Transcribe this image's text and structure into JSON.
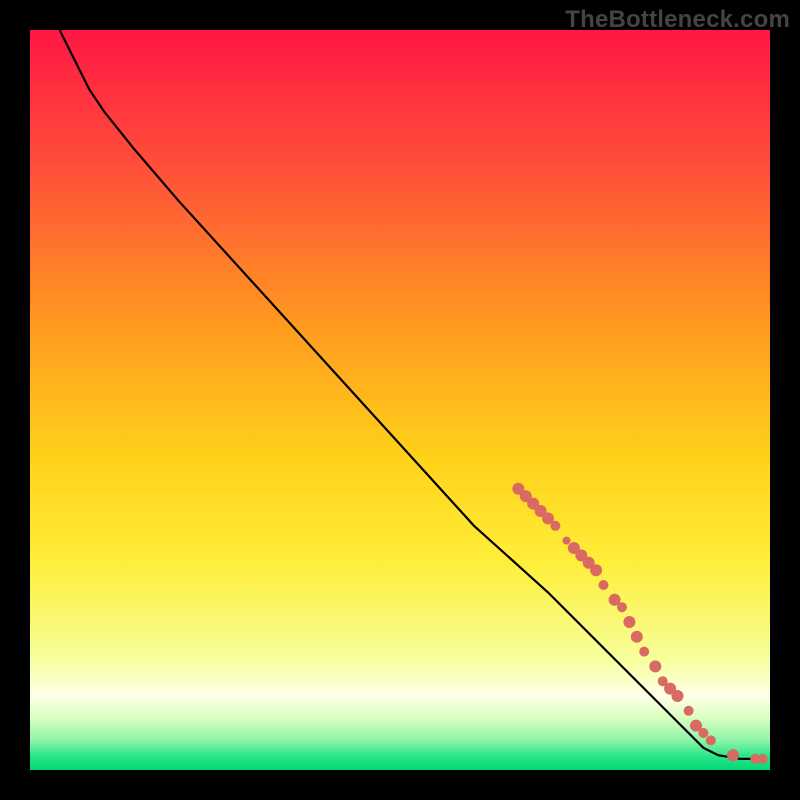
{
  "watermark": "TheBottleneck.com",
  "chart_data": {
    "type": "line",
    "title": "",
    "xlabel": "",
    "ylabel": "",
    "xlim": [
      0,
      100
    ],
    "ylim": [
      0,
      100
    ],
    "gradient_stops": [
      {
        "offset": 0.0,
        "color": "#ff1744"
      },
      {
        "offset": 0.18,
        "color": "#ff4d3a"
      },
      {
        "offset": 0.4,
        "color": "#ff9a1f"
      },
      {
        "offset": 0.58,
        "color": "#ffd21a"
      },
      {
        "offset": 0.72,
        "color": "#ffee3a"
      },
      {
        "offset": 0.85,
        "color": "#f6ff9a"
      },
      {
        "offset": 0.9,
        "color": "#ffffe8"
      },
      {
        "offset": 0.93,
        "color": "#d9ffc0"
      },
      {
        "offset": 0.96,
        "color": "#8cf5a8"
      },
      {
        "offset": 0.98,
        "color": "#2ee68a"
      },
      {
        "offset": 1.0,
        "color": "#00d975"
      }
    ],
    "curve": [
      {
        "x": 4,
        "y": 100
      },
      {
        "x": 6,
        "y": 96
      },
      {
        "x": 8,
        "y": 92
      },
      {
        "x": 10,
        "y": 89
      },
      {
        "x": 14,
        "y": 84
      },
      {
        "x": 20,
        "y": 77
      },
      {
        "x": 30,
        "y": 66
      },
      {
        "x": 40,
        "y": 55
      },
      {
        "x": 50,
        "y": 44
      },
      {
        "x": 60,
        "y": 33
      },
      {
        "x": 70,
        "y": 24
      },
      {
        "x": 78,
        "y": 16
      },
      {
        "x": 84,
        "y": 10
      },
      {
        "x": 88,
        "y": 6
      },
      {
        "x": 91,
        "y": 3
      },
      {
        "x": 93,
        "y": 2
      },
      {
        "x": 96,
        "y": 1.5
      },
      {
        "x": 99,
        "y": 1.5
      }
    ],
    "markers": [
      {
        "x": 66,
        "y": 38,
        "r": 6
      },
      {
        "x": 67,
        "y": 37,
        "r": 6
      },
      {
        "x": 68,
        "y": 36,
        "r": 6
      },
      {
        "x": 69,
        "y": 35,
        "r": 6
      },
      {
        "x": 70,
        "y": 34,
        "r": 6
      },
      {
        "x": 71,
        "y": 33,
        "r": 5
      },
      {
        "x": 72.5,
        "y": 31,
        "r": 4
      },
      {
        "x": 73.5,
        "y": 30,
        "r": 6
      },
      {
        "x": 74.5,
        "y": 29,
        "r": 6
      },
      {
        "x": 75.5,
        "y": 28,
        "r": 6
      },
      {
        "x": 76.5,
        "y": 27,
        "r": 6
      },
      {
        "x": 77.5,
        "y": 25,
        "r": 5
      },
      {
        "x": 79,
        "y": 23,
        "r": 6
      },
      {
        "x": 80,
        "y": 22,
        "r": 5
      },
      {
        "x": 81,
        "y": 20,
        "r": 6
      },
      {
        "x": 82,
        "y": 18,
        "r": 6
      },
      {
        "x": 83,
        "y": 16,
        "r": 5
      },
      {
        "x": 84.5,
        "y": 14,
        "r": 6
      },
      {
        "x": 85.5,
        "y": 12,
        "r": 5
      },
      {
        "x": 86.5,
        "y": 11,
        "r": 6
      },
      {
        "x": 87.5,
        "y": 10,
        "r": 6
      },
      {
        "x": 89,
        "y": 8,
        "r": 5
      },
      {
        "x": 90,
        "y": 6,
        "r": 6
      },
      {
        "x": 91,
        "y": 5,
        "r": 5
      },
      {
        "x": 92,
        "y": 4,
        "r": 5
      },
      {
        "x": 95,
        "y": 2,
        "r": 6
      },
      {
        "x": 98,
        "y": 1.5,
        "r": 5
      },
      {
        "x": 99,
        "y": 1.5,
        "r": 5
      }
    ],
    "marker_color": "#d96a62",
    "curve_color": "#000000"
  }
}
